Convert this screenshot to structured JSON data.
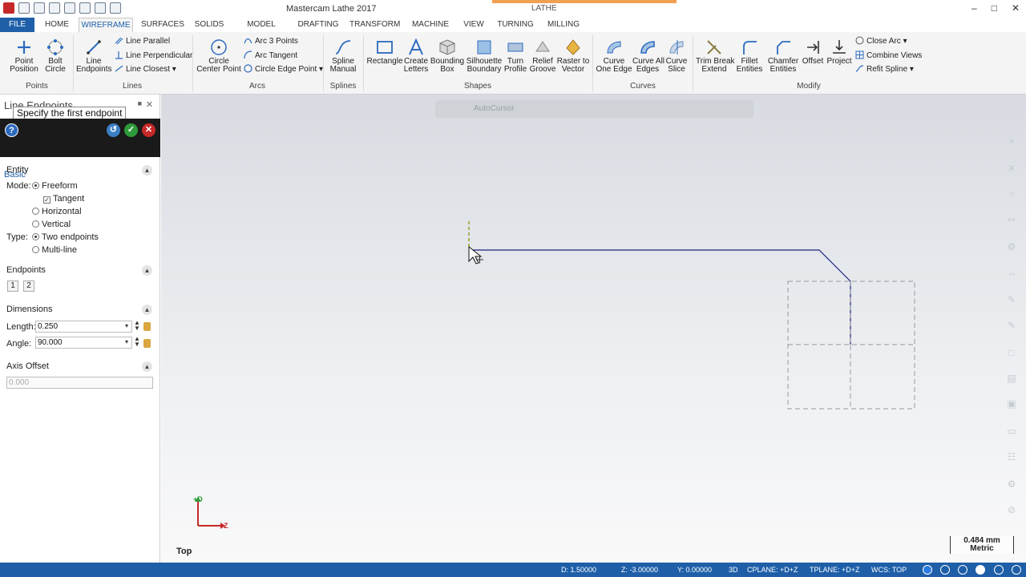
{
  "window": {
    "title": "Mastercam Lathe 2017",
    "context_tab": "LATHE",
    "min": "–",
    "max": "□",
    "close": "✕"
  },
  "tabs": [
    "FILE",
    "HOME",
    "WIREFRAME",
    "SURFACES",
    "SOLIDS",
    "MODEL PREP",
    "DRAFTING",
    "TRANSFORM",
    "MACHINE",
    "VIEW",
    "TURNING",
    "MILLING"
  ],
  "active_tab": "WIREFRAME",
  "ribbon": {
    "points": {
      "label": "Points",
      "point_position": "Point\nPosition",
      "bolt_circle": "Bolt\nCircle"
    },
    "lines": {
      "label": "Lines",
      "line_endpoints": "Line\nEndpoints",
      "line_parallel": "Line Parallel",
      "line_perpendicular": "Line Perpendicular",
      "line_closest": "Line Closest"
    },
    "arcs": {
      "label": "Arcs",
      "circle_center_point": "Circle\nCenter Point",
      "arc_3_points": "Arc 3 Points",
      "arc_tangent": "Arc Tangent",
      "circle_edge_point": "Circle Edge Point"
    },
    "splines": {
      "label": "Splines",
      "spline_manual": "Spline\nManual"
    },
    "shapes": {
      "label": "Shapes",
      "rectangle": "Rectangle",
      "create_letters": "Create\nLetters",
      "bounding_box": "Bounding\nBox",
      "silhouette_boundary": "Silhouette\nBoundary",
      "turn_profile": "Turn\nProfile",
      "relief_groove": "Relief\nGroove",
      "raster_to_vector": "Raster to\nVector"
    },
    "curves": {
      "label": "Curves",
      "curve_one_edge": "Curve\nOne Edge",
      "curve_all_edges": "Curve All\nEdges",
      "curve_slice": "Curve\nSlice"
    },
    "modify": {
      "label": "Modify",
      "trim_break_extend": "Trim Break\nExtend",
      "fillet_entities": "Fillet\nEntities",
      "chamfer_entities": "Chamfer\nEntities",
      "offset": "Offset",
      "project": "Project",
      "close_arc": "Close Arc",
      "combine_views": "Combine Views",
      "refit_spline": "Refit Spline"
    }
  },
  "panel": {
    "title": "Line Endpoints",
    "tooltip": "Specify the first endpoint",
    "tab": "Basic",
    "entity": {
      "header": "Entity",
      "mode_label": "Mode:",
      "freeform": "Freeform",
      "tangent": "Tangent",
      "horizontal": "Horizontal",
      "vertical": "Vertical",
      "type_label": "Type:",
      "two_endpoints": "Two endpoints",
      "multi_line": "Multi-line"
    },
    "endpoints": {
      "header": "Endpoints",
      "btn1": "1",
      "btn2": "2"
    },
    "dimensions": {
      "header": "Dimensions",
      "length_label": "Length:",
      "length_value": "0.250",
      "angle_label": "Angle:",
      "angle_value": "90.000"
    },
    "axis_offset": {
      "header": "Axis Offset",
      "value": "0.000"
    }
  },
  "viewport": {
    "autocursor": "AutoCursor",
    "view_name": "Top",
    "axis_d": "+D",
    "axis_z": "Z",
    "scale_value": "0.484 mm",
    "scale_unit": "Metric"
  },
  "status": {
    "d": "D:  1.50000",
    "z": "Z:  -3.00000",
    "y": "Y:  0.00000",
    "mode": "3D",
    "cplane": "CPLANE: +D+Z",
    "tplane": "TPLANE: +D+Z",
    "wcs": "WCS: TOP"
  },
  "colors": {
    "accent": "#1e5fa8",
    "geometry": "#1a237e",
    "cursor_line": "#9e9d24"
  }
}
